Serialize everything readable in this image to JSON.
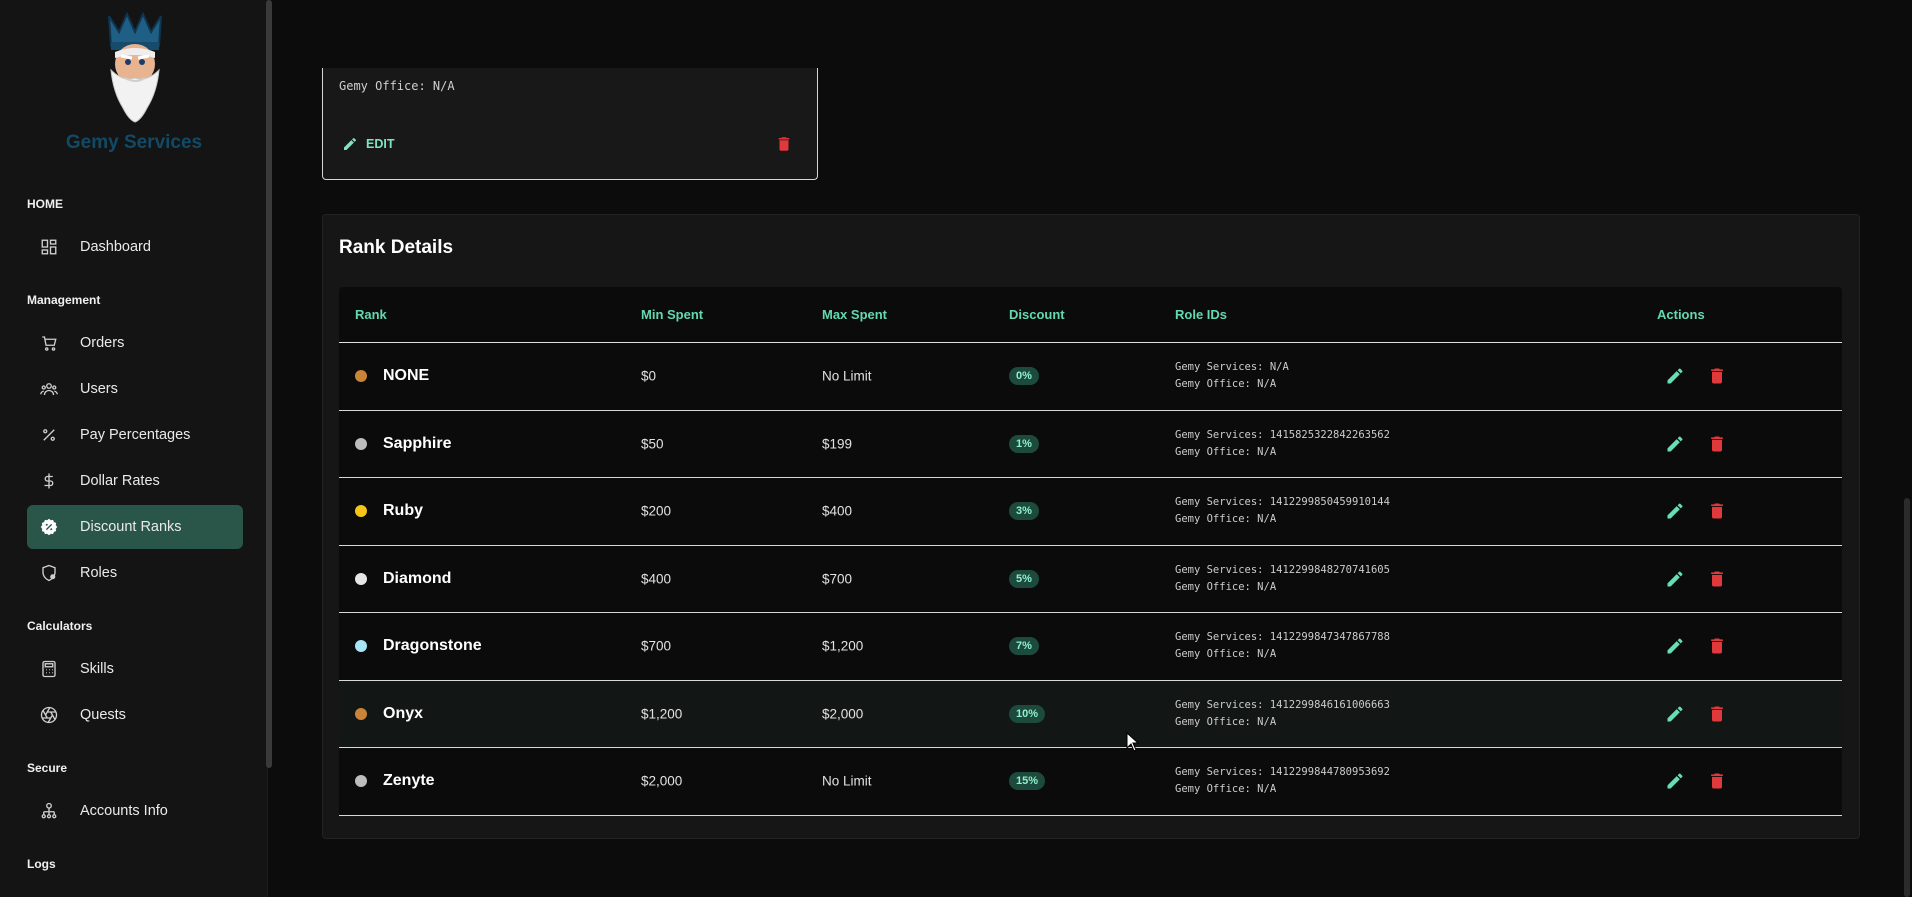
{
  "brand": {
    "name": "Gemy Services"
  },
  "sidebar": {
    "sections": [
      {
        "label": "HOME",
        "items": [
          {
            "label": "Dashboard",
            "icon": "dashboard-icon"
          }
        ]
      },
      {
        "label": "Management",
        "items": [
          {
            "label": "Orders",
            "icon": "cart-icon"
          },
          {
            "label": "Users",
            "icon": "users-icon"
          },
          {
            "label": "Pay Percentages",
            "icon": "percent-icon"
          },
          {
            "label": "Dollar Rates",
            "icon": "dollar-icon"
          },
          {
            "label": "Discount Ranks",
            "icon": "discount-badge-icon",
            "active": true
          },
          {
            "label": "Roles",
            "icon": "shield-gear-icon"
          }
        ]
      },
      {
        "label": "Calculators",
        "items": [
          {
            "label": "Skills",
            "icon": "calculator-icon"
          },
          {
            "label": "Quests",
            "icon": "aperture-icon"
          }
        ]
      },
      {
        "label": "Secure",
        "items": [
          {
            "label": "Accounts Info",
            "icon": "account-tree-icon"
          }
        ]
      },
      {
        "label": "Logs",
        "items": []
      }
    ]
  },
  "top_card": {
    "office_text": "Gemy Office: N/A",
    "edit_label": "EDIT"
  },
  "rank_details": {
    "title": "Rank Details",
    "columns": [
      "Rank",
      "Min Spent",
      "Max Spent",
      "Discount",
      "Role IDs",
      "Actions"
    ],
    "rows": [
      {
        "rank": "NONE",
        "dot": "#c9843a",
        "min": "$0",
        "max": "No Limit",
        "discount": "0%",
        "services": "Gemy Services: N/A",
        "office": "Gemy Office: N/A"
      },
      {
        "rank": "Sapphire",
        "dot": "#bdbdbd",
        "min": "$50",
        "max": "$199",
        "discount": "1%",
        "services": "Gemy Services: 1415825322842263562",
        "office": "Gemy Office: N/A"
      },
      {
        "rank": "Ruby",
        "dot": "#f5c518",
        "min": "$200",
        "max": "$400",
        "discount": "3%",
        "services": "Gemy Services: 1412299850459910144",
        "office": "Gemy Office: N/A"
      },
      {
        "rank": "Diamond",
        "dot": "#e6e6e6",
        "min": "$400",
        "max": "$700",
        "discount": "5%",
        "services": "Gemy Services: 1412299848270741605",
        "office": "Gemy Office: N/A"
      },
      {
        "rank": "Dragonstone",
        "dot": "#a8e6f5",
        "min": "$700",
        "max": "$1,200",
        "discount": "7%",
        "services": "Gemy Services: 1412299847347867788",
        "office": "Gemy Office: N/A"
      },
      {
        "rank": "Onyx",
        "dot": "#c9843a",
        "min": "$1,200",
        "max": "$2,000",
        "discount": "10%",
        "services": "Gemy Services: 1412299846161006663",
        "office": "Gemy Office: N/A",
        "hover": true
      },
      {
        "rank": "Zenyte",
        "dot": "#bdbdbd",
        "min": "$2,000",
        "max": "No Limit",
        "discount": "15%",
        "services": "Gemy Services: 1412299844780953692",
        "office": "Gemy Office: N/A"
      }
    ]
  },
  "colors": {
    "accent": "#63d8b2",
    "active_nav": "#2a5649",
    "danger": "#e0393c",
    "brand": "#124a66"
  }
}
